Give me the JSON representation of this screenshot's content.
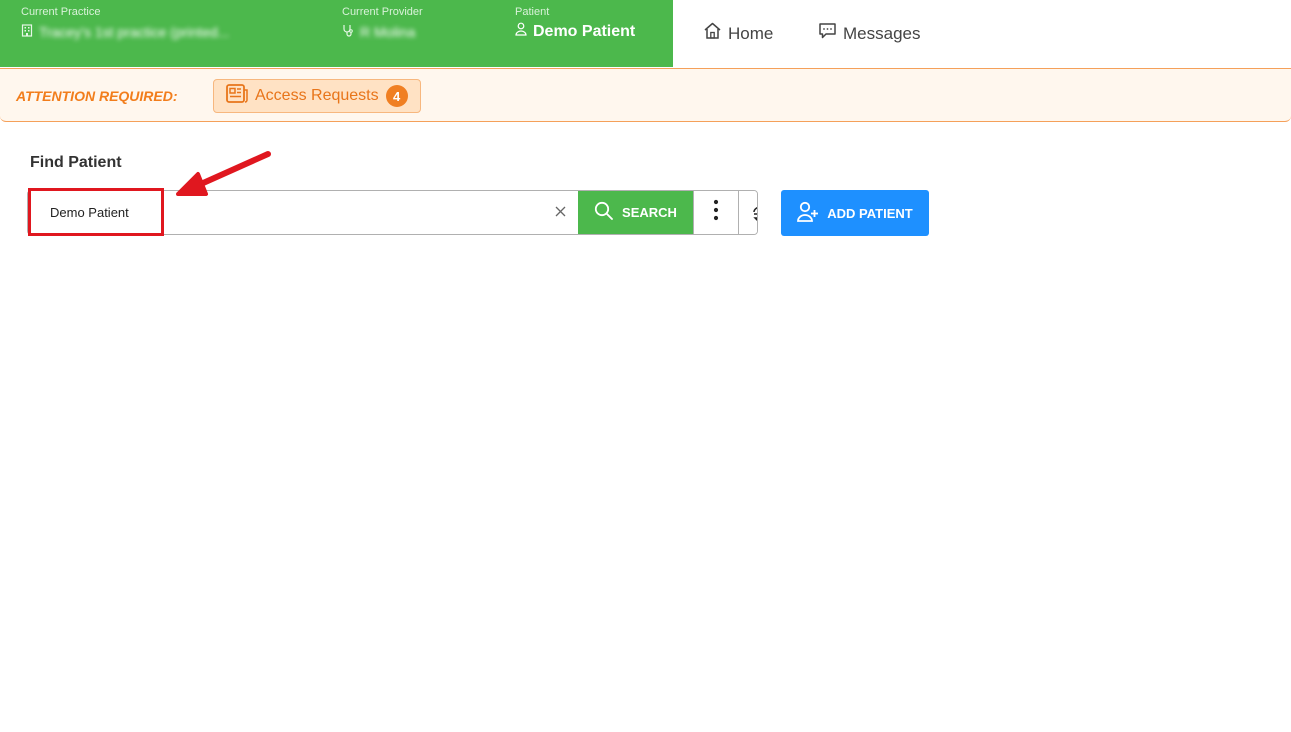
{
  "topbar": {
    "practice": {
      "label": "Current Practice",
      "value": "Tracey's 1st practice (printed..."
    },
    "provider": {
      "label": "Current Provider",
      "value": "R Molina"
    },
    "patient": {
      "label": "Patient",
      "value": "Demo Patient"
    },
    "nav": {
      "home": "Home",
      "messages": "Messages"
    }
  },
  "attention": {
    "label": "ATTENTION REQUIRED:",
    "access_requests": {
      "label": "Access Requests",
      "count": "4"
    }
  },
  "find_patient": {
    "title": "Find Patient",
    "search_value": "Demo Patient",
    "clear_symbol": "×",
    "search_button": "SEARCH",
    "more_symbol": "⋮",
    "add_patient_button": "ADD PATIENT"
  },
  "colors": {
    "green": "#4cb84c",
    "orange": "#f27d1b",
    "blue": "#1e90ff",
    "annotation_red": "#e0171f"
  },
  "icons": {
    "practice": "building-icon",
    "provider": "stethoscope-icon",
    "patient": "user-icon",
    "home": "home-icon",
    "messages": "message-icon",
    "access_requests": "document-list-icon",
    "clear": "close-icon",
    "search": "search-icon",
    "more": "kebab-menu-icon",
    "switch": "switch-user-icon",
    "add_patient": "add-user-icon"
  }
}
